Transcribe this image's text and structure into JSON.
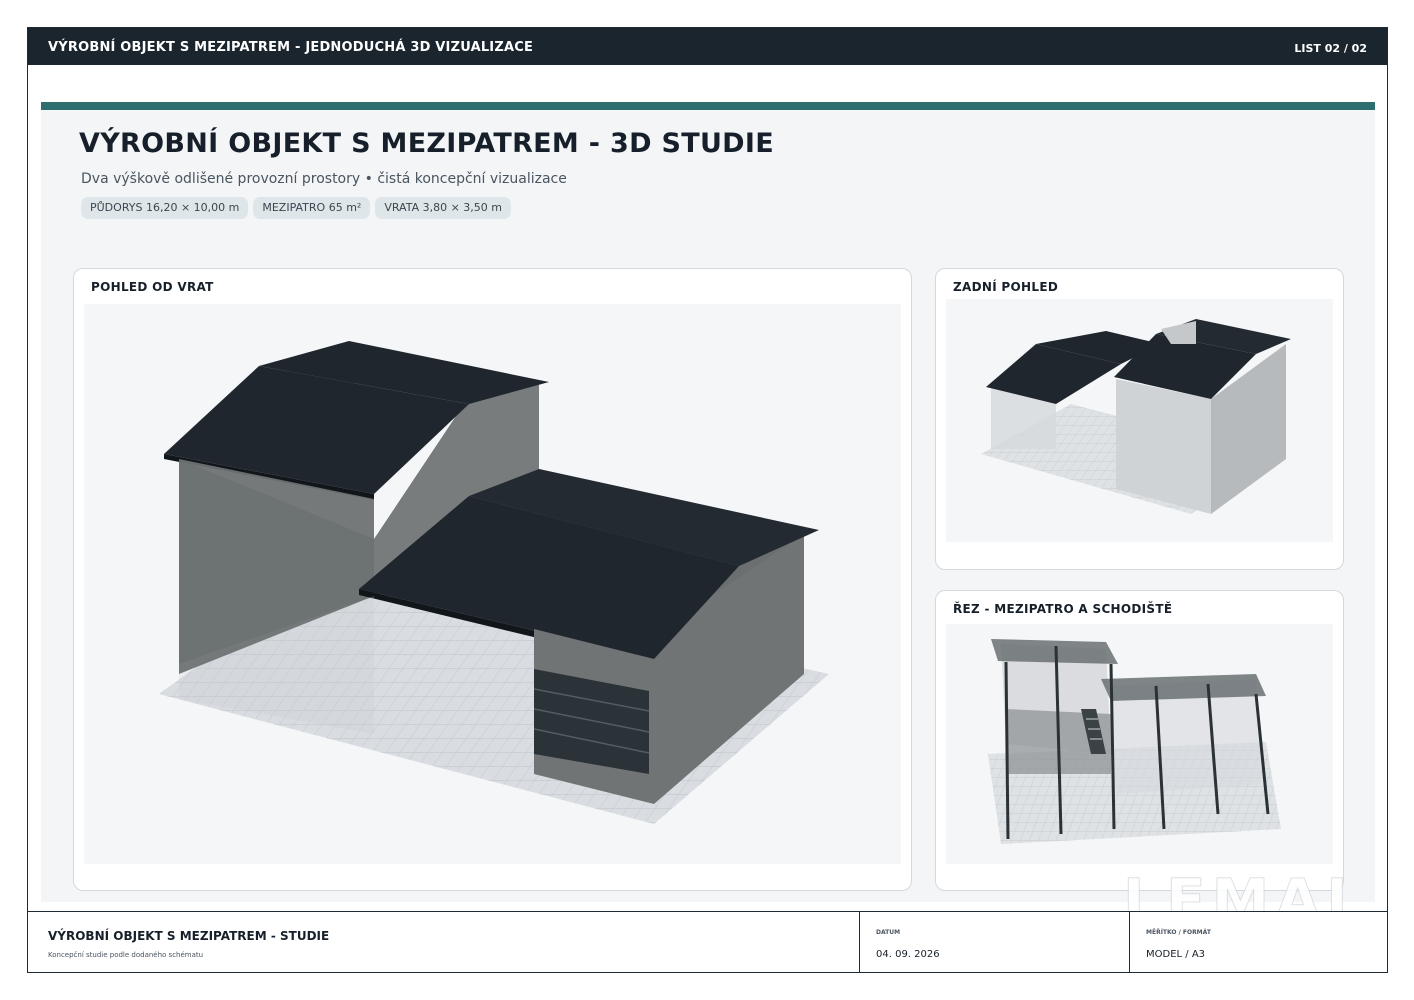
{
  "header": {
    "title": "VÝROBNÍ OBJEKT S MEZIPATREM - JEDNODUCHÁ 3D VIZUALIZACE",
    "sheet": "LIST 02 / 02"
  },
  "main": {
    "title": "VÝROBNÍ OBJEKT S MEZIPATREM - 3D STUDIE",
    "subtitle": "Dva výškově odlišené provozní prostory • čistá koncepční vizualizace",
    "chips": [
      "PŮDORYS 16,20 × 10,00 m",
      "MEZIPATRO 65 m²",
      "VRATA 3,80 × 3,50 m"
    ]
  },
  "panels": {
    "front": {
      "title": "POHLED OD VRAT"
    },
    "back": {
      "title": "ZADNÍ POHLED"
    },
    "section": {
      "title": "ŘEZ - MEZIPATRO A SCHODIŠTĚ"
    }
  },
  "footer": {
    "title": "VÝROBNÍ OBJEKT S MEZIPATREM - STUDIE",
    "subtitle": "Koncepční studie podle dodaného schématu",
    "date_label": "DATUM",
    "date": "04. 09. 2026",
    "scale_label": "MĚŘÍTKO / FORMÁT",
    "scale": "MODEL / A3"
  },
  "watermark": "LEMAI",
  "colors": {
    "accent": "#2e6e6e",
    "roof": "#1f262d",
    "wall": "#6f7374",
    "topbar": "#1b252e"
  }
}
